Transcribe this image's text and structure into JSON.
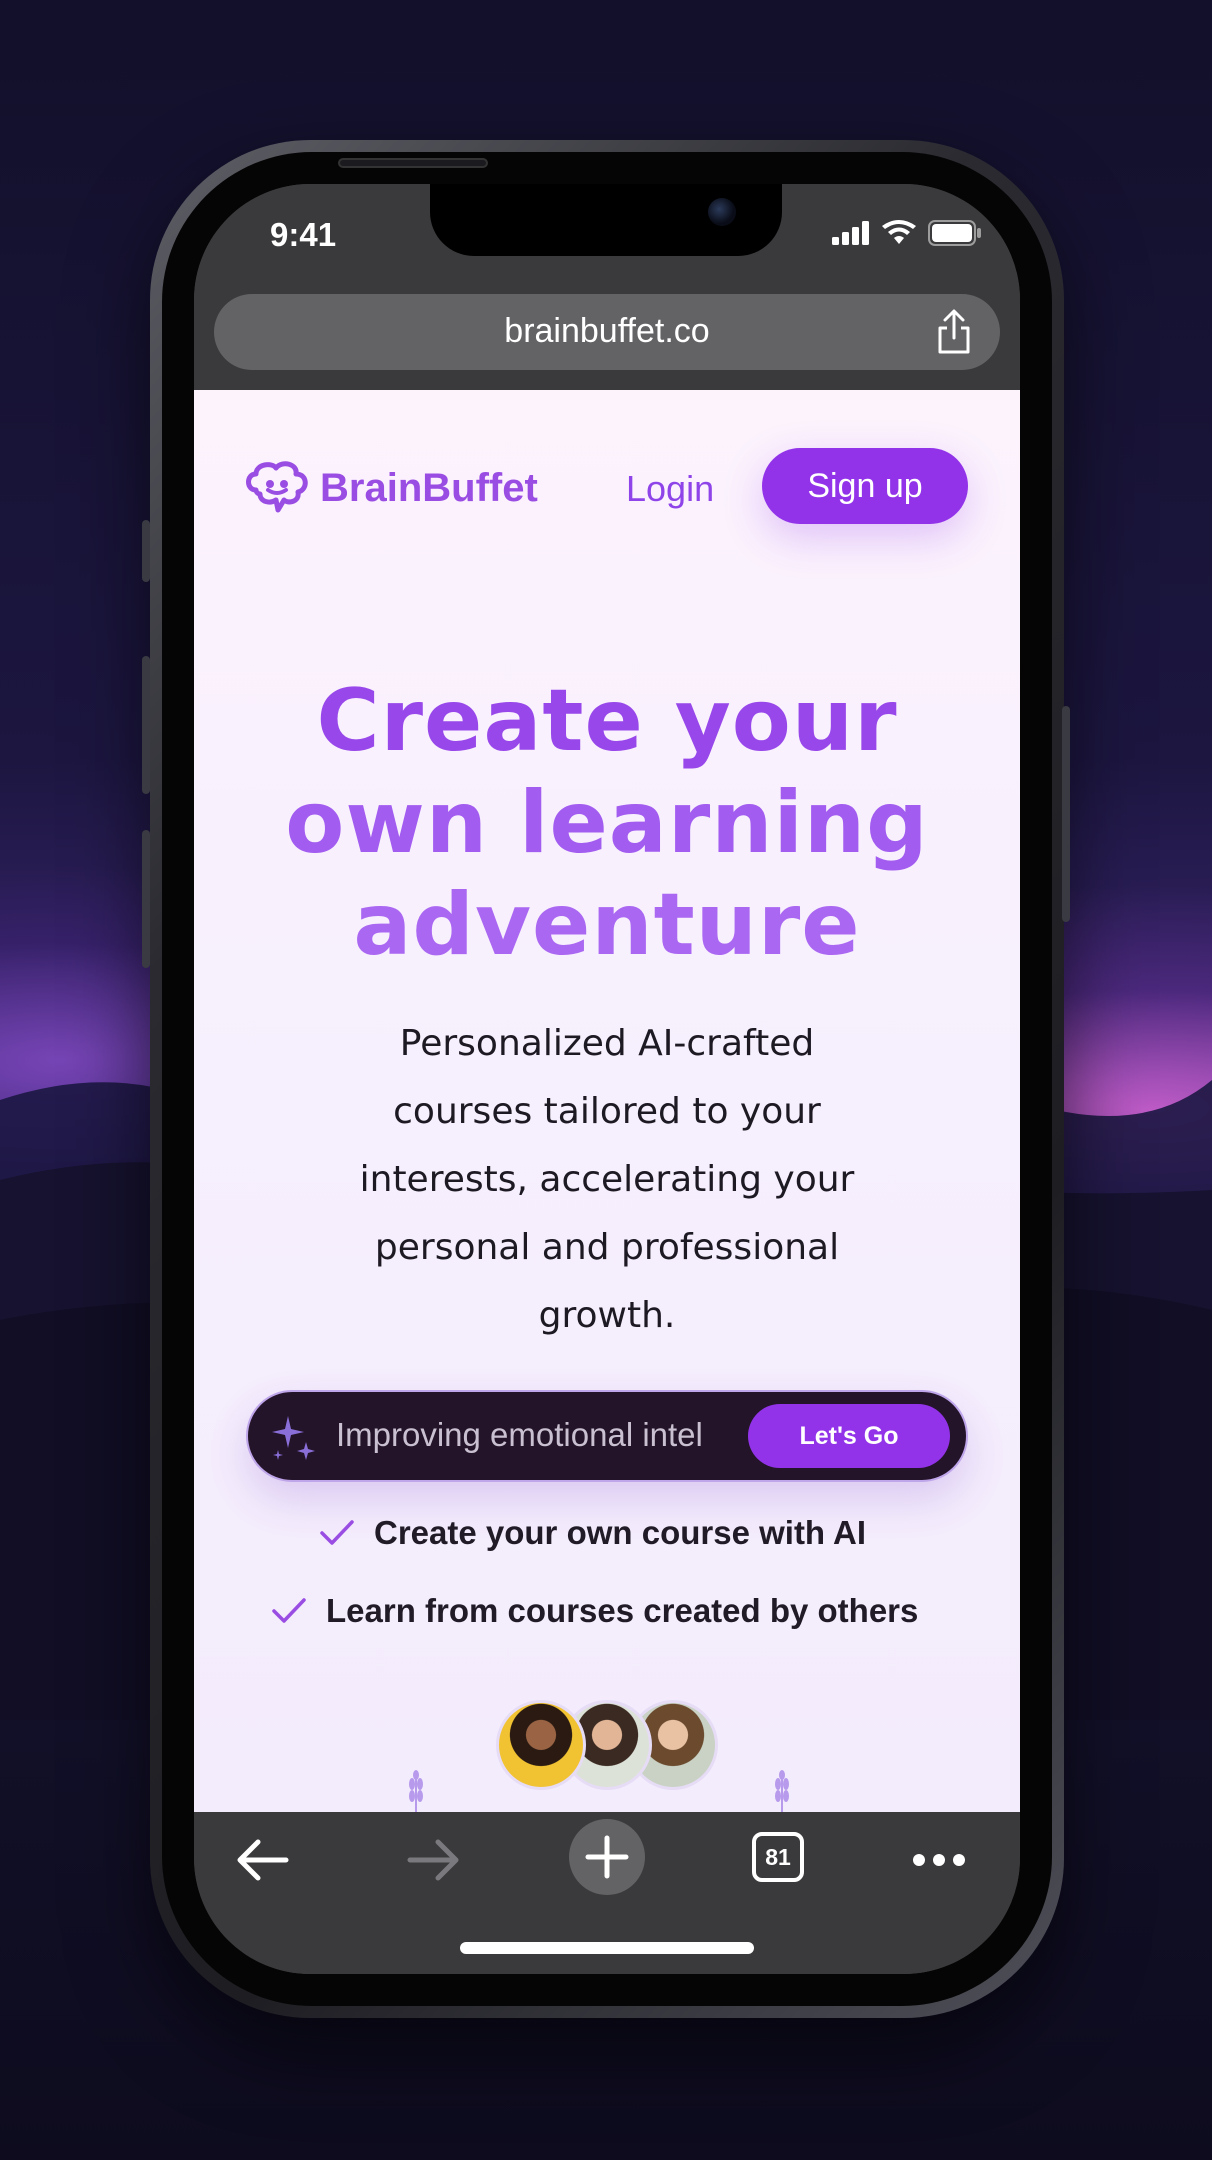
{
  "status_bar": {
    "time": "9:41"
  },
  "browser": {
    "url": "brainbuffet.co",
    "tab_count": "81"
  },
  "site": {
    "brand": "BrainBuffet",
    "login_label": "Login",
    "signup_label": "Sign up",
    "hero_lines": [
      "Create your",
      "own learning",
      "adventure"
    ],
    "subtitle_lines": [
      "Personalized AI-crafted",
      "courses tailored to your",
      "interests, accelerating your",
      "personal and professional",
      "growth."
    ],
    "prompt_value": "Improving emotional intel",
    "go_label": "Let's Go",
    "features": [
      "Create your own course with AI",
      "Learn from courses created by others"
    ]
  },
  "colors": {
    "accent": "#9233ea",
    "hero_gradient": [
      "#9848ea",
      "#aa67f2"
    ],
    "page_bg": "#fcf3fd",
    "prompt_bg": "#241429",
    "toolbar_bg": "#3a3a3c"
  },
  "icons": {
    "brand": "brain-icon",
    "share": "share-icon",
    "prompt": "sparkle-icon",
    "check": "check-icon",
    "back": "arrow-left-icon",
    "forward": "arrow-right-icon",
    "new_tab": "plus-icon",
    "tabs": "tabs-icon",
    "more": "more-icon"
  }
}
